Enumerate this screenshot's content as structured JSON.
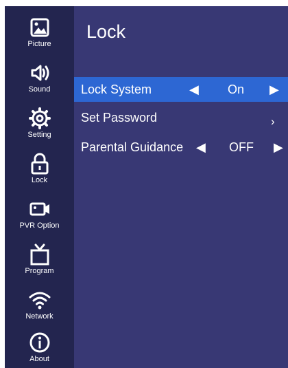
{
  "sidebar": {
    "items": [
      {
        "label": "Picture",
        "icon": "picture-icon"
      },
      {
        "label": "Sound",
        "icon": "sound-icon"
      },
      {
        "label": "Setting",
        "icon": "setting-gear-icon"
      },
      {
        "label": "Lock",
        "icon": "lock-icon"
      },
      {
        "label": "PVR Option",
        "icon": "camera-icon"
      },
      {
        "label": "Program",
        "icon": "tv-icon"
      },
      {
        "label": "Network",
        "icon": "wifi-icon"
      },
      {
        "label": "About",
        "icon": "info-icon"
      }
    ]
  },
  "main": {
    "title": "Lock",
    "rows": [
      {
        "label": "Lock System",
        "value": "On",
        "selected": true
      },
      {
        "label": "Set Password",
        "value": ""
      },
      {
        "label": "Parental Guidance",
        "value": "OFF"
      }
    ]
  },
  "colors": {
    "sidebar_bg": "#23254f",
    "main_bg": "#383874",
    "selected_bg": "#2d67d3",
    "text": "#ffffff"
  }
}
